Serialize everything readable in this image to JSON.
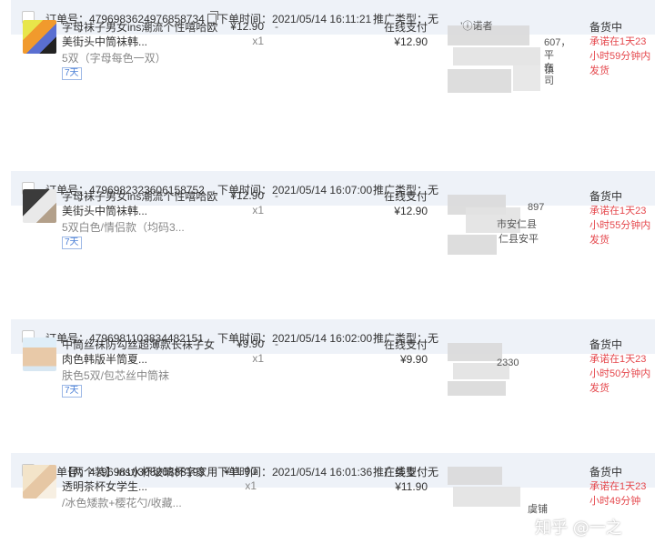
{
  "labels": {
    "order_no_prefix": "订单号：",
    "time_prefix": "下单时间：",
    "promo_prefix": "推广类型：",
    "pay_method": "在线支付",
    "status": "备货中",
    "tag": "7天",
    "dash": "-"
  },
  "orders": [
    {
      "order_no": "4796983624976858734",
      "time": "2021/05/14 16:11:21",
      "promo": "无",
      "title": "字母袜子男女ins潮流个性嘻哈欧美街头中筒袜韩...",
      "spec": "5双（字母每色一双）",
      "price": "¥12.90",
      "qty": "x1",
      "pay_amount": "¥12.90",
      "addr_fragments": [
        "’ⓘ诺者",
        "607，",
        "平镇",
        "东",
        "司"
      ],
      "promise": "承诺在1天23小时59分钟内发货"
    },
    {
      "order_no": "4796982323606158752",
      "time": "2021/05/14 16:07:00",
      "promo": "无",
      "title": "字母袜子男女ins潮流个性嘻哈欧美街头中筒袜韩...",
      "spec": "5双白色/情侣款（均码3...",
      "price": "¥12.90",
      "qty": "x1",
      "pay_amount": "¥12.90",
      "addr_fragments": [
        "897",
        "市安仁县",
        "仁县安平"
      ],
      "promise": "承诺在1天23小时55分钟内发货"
    },
    {
      "order_no": "4796981103834482151",
      "time": "2021/05/14 16:02:00",
      "promo": "无",
      "title": "中筒丝袜防勾丝超薄款长袜子女肉色韩版半筒夏...",
      "spec": "肤色5双/包芯丝中筒袜",
      "price": "¥9.90",
      "qty": "x1",
      "pay_amount": "¥9.90",
      "addr_fragments": [
        "2330"
      ],
      "promise": "承诺在1天23小时50分钟内发货"
    },
    {
      "order_no": "4796981030820388193",
      "time": "2021/05/14 16:01:36",
      "promo": "无",
      "title": "【两个装】ins水杯玻璃杯字家用透明茶杯女学生...",
      "spec": "/冰色矮款+樱花勺/收藏...",
      "price": "¥11.90",
      "qty": "x1",
      "pay_amount": "¥11.90",
      "addr_fragments": [
        "虞铺"
      ],
      "promise": "承诺在1天23小时49分钟"
    }
  ],
  "watermark": "知乎 @一之",
  "colors": {
    "header_bg": "#eef2f8",
    "warn": "#e5484d",
    "tag": "#4a7fd6"
  }
}
